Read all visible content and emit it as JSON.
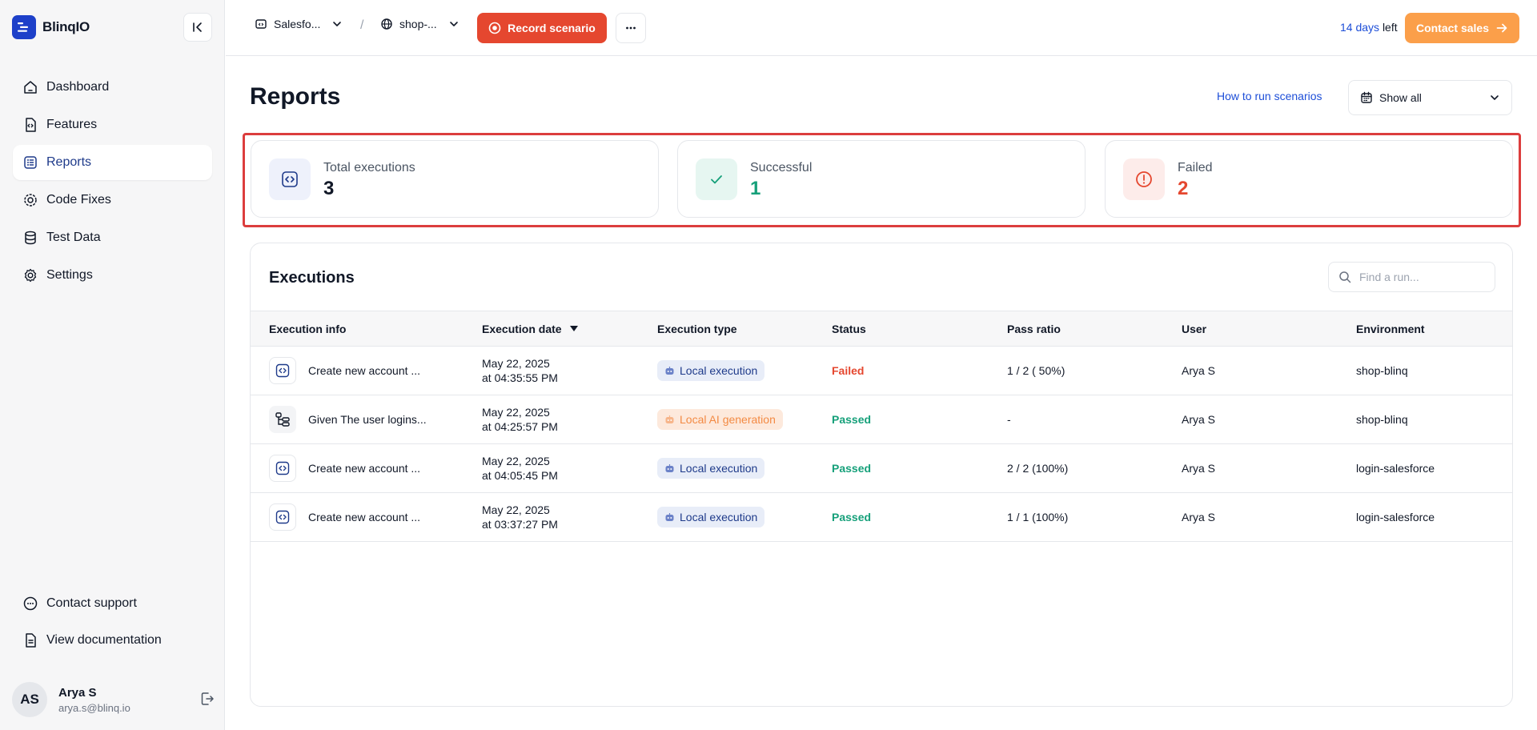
{
  "app": {
    "name": "BlinqIO"
  },
  "sidebar": {
    "items": [
      {
        "label": "Dashboard",
        "icon": "home-icon"
      },
      {
        "label": "Features",
        "icon": "feature-file-icon"
      },
      {
        "label": "Reports",
        "icon": "list-icon",
        "active": true
      },
      {
        "label": "Code Fixes",
        "icon": "gear-code-icon"
      },
      {
        "label": "Test Data",
        "icon": "database-icon"
      },
      {
        "label": "Settings",
        "icon": "gear-icon"
      }
    ],
    "bottom": [
      {
        "label": "Contact support",
        "icon": "chat-icon"
      },
      {
        "label": "View documentation",
        "icon": "document-icon"
      }
    ],
    "user": {
      "initials": "AS",
      "name": "Arya S",
      "email": "arya.s@blinq.io"
    }
  },
  "topbar": {
    "project": "Salesfo...",
    "environment": "shop-...",
    "separator": "/",
    "record_label": "Record scenario",
    "trial_days": "14 days",
    "trial_left": "left",
    "contact_sales": "Contact sales"
  },
  "page": {
    "title": "Reports",
    "howto_link": "How to run scenarios",
    "filter_label": "Show all"
  },
  "stats": [
    {
      "label": "Total executions",
      "value": "3",
      "color": "#111827",
      "icon_bg": "#eef1fb",
      "icon": "code-icon"
    },
    {
      "label": "Successful",
      "value": "1",
      "color": "#16a07a",
      "icon_bg": "#e6f6f1",
      "icon": "check-icon"
    },
    {
      "label": "Failed",
      "value": "2",
      "color": "#e5472f",
      "icon_bg": "#fdecea",
      "icon": "alert-icon"
    }
  ],
  "executions": {
    "title": "Executions",
    "search_placeholder": "Find a run...",
    "columns": [
      "Execution info",
      "Execution date",
      "Execution type",
      "Status",
      "Pass ratio",
      "User",
      "Environment"
    ],
    "rows": [
      {
        "icon": "code-icon",
        "scenario": "Create new account ...",
        "date_line1": "May 22, 2025",
        "date_line2": "at 04:35:55 PM",
        "type": "Local execution",
        "type_kind": "local",
        "status": "Failed",
        "ratio": "1 / 2 ( 50%)",
        "user": "Arya S",
        "env": "shop-blinq"
      },
      {
        "icon": "steps-icon",
        "scenario": "Given The user logins...",
        "date_line1": "May 22, 2025",
        "date_line2": "at 04:25:57 PM",
        "type": "Local AI generation",
        "type_kind": "ai",
        "status": "Passed",
        "ratio": "-",
        "user": "Arya S",
        "env": "shop-blinq"
      },
      {
        "icon": "code-icon",
        "scenario": "Create new account ...",
        "date_line1": "May 22, 2025",
        "date_line2": "at 04:05:45 PM",
        "type": "Local execution",
        "type_kind": "local",
        "status": "Passed",
        "ratio": "2 / 2 (100%)",
        "user": "Arya S",
        "env": "login-salesforce"
      },
      {
        "icon": "code-icon",
        "scenario": "Create new account ...",
        "date_line1": "May 22, 2025",
        "date_line2": "at 03:37:27 PM",
        "type": "Local execution",
        "type_kind": "local",
        "status": "Passed",
        "ratio": "1 / 1 (100%)",
        "user": "Arya S",
        "env": "login-salesforce"
      }
    ]
  }
}
